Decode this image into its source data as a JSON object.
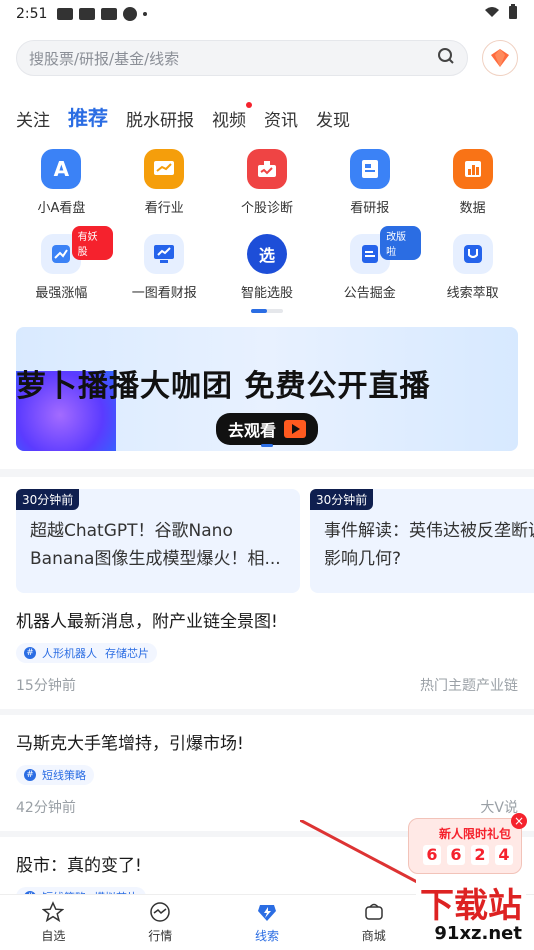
{
  "status": {
    "time": "2:51",
    "icons": [
      "message-icon",
      "message-icon",
      "message-icon",
      "compass-icon",
      "dot-icon"
    ],
    "right_icons": [
      "wifi-icon",
      "battery-icon"
    ]
  },
  "search": {
    "placeholder": "搜股票/研报/基金/线索"
  },
  "tabs": [
    {
      "label": "关注",
      "active": false
    },
    {
      "label": "推荐",
      "active": true
    },
    {
      "label": "脱水研报",
      "active": false
    },
    {
      "label": "视频",
      "active": false,
      "dot": true
    },
    {
      "label": "资讯",
      "active": false
    },
    {
      "label": "发现",
      "active": false
    }
  ],
  "grid": {
    "row1": [
      {
        "label": "小A看盘",
        "icon": "A",
        "color": "#3b82f6"
      },
      {
        "label": "看行业",
        "icon": "chart",
        "color": "#f59e0b"
      },
      {
        "label": "个股诊断",
        "icon": "bag",
        "color": "#ef4444"
      },
      {
        "label": "看研报",
        "icon": "doc",
        "color": "#3b82f6"
      },
      {
        "label": "数据",
        "icon": "bar",
        "color": "#f97316"
      }
    ],
    "row2": [
      {
        "label": "最强涨幅",
        "icon": "trend",
        "color": "#3b82f6",
        "badge": "有妖股"
      },
      {
        "label": "一图看财报",
        "icon": "monitor",
        "color": "#2563eb"
      },
      {
        "label": "智能选股",
        "icon": "选",
        "color": "#1d4ed8"
      },
      {
        "label": "公告掘金",
        "icon": "notice",
        "color": "#2563eb",
        "badge": "改版啦"
      },
      {
        "label": "线索萃取",
        "icon": "magnet",
        "color": "#2563eb"
      }
    ]
  },
  "banner": {
    "title": "萝卜播播大咖团 免费公开直播",
    "cta": "去观看"
  },
  "cards": [
    {
      "time": "30分钟前",
      "text": "超越ChatGPT！谷歌Nano Banana图像生成模型爆火！相..."
    },
    {
      "time": "30分钟前",
      "text": "事件解读：英伟达被反垄断调查，影响几何?"
    }
  ],
  "items": [
    {
      "title": "机器人最新消息，附产业链全景图!",
      "tags": [
        "人形机器人",
        "存储芯片"
      ],
      "time": "15分钟前",
      "source": "热门主题产业链"
    },
    {
      "title": "马斯克大手笔增持，引爆市场!",
      "tags": [
        "短线策略"
      ],
      "time": "42分钟前",
      "source": "大V说"
    },
    {
      "title": "股市：真的变了!",
      "tags": [
        "短线策略",
        "模拟芯片"
      ]
    }
  ],
  "gift": {
    "label": "新人限时礼包",
    "digits": [
      "6",
      "6",
      "2",
      "4"
    ]
  },
  "nav": [
    {
      "label": "自选",
      "icon": "star-icon",
      "active": false
    },
    {
      "label": "行情",
      "icon": "pulse-icon",
      "active": false
    },
    {
      "label": "线索",
      "icon": "lightning-icon",
      "active": true
    },
    {
      "label": "商城",
      "icon": "cart-icon",
      "active": false
    },
    {
      "label": "我的",
      "icon": "user-icon",
      "active": false
    }
  ],
  "watermark": {
    "cn": "下载站",
    "en": "91xz.net"
  }
}
